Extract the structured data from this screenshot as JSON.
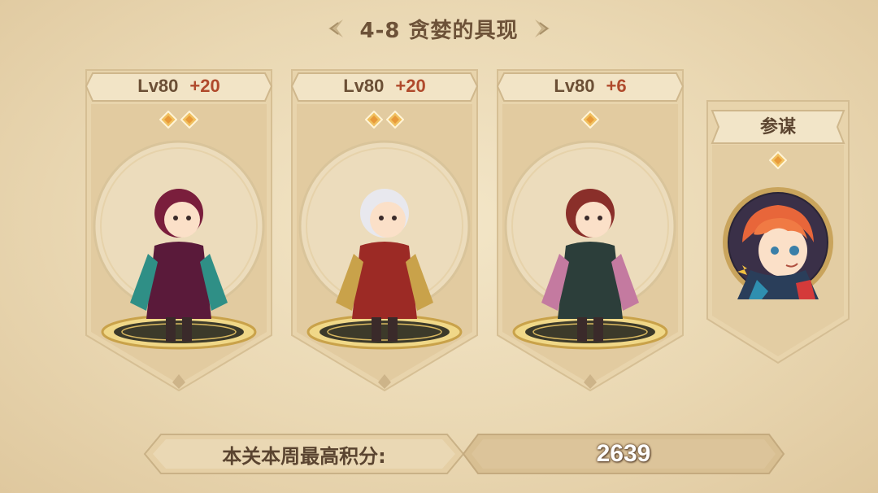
{
  "stage": {
    "title": "4-8 贪婪的具现"
  },
  "heroes": [
    {
      "level": "Lv80",
      "bonus": "+20",
      "stars": 2,
      "character": "sorceress",
      "colors": {
        "hair": "#7a1e3c",
        "robe": "#5a1a3a",
        "accent": "#2f8f86"
      }
    },
    {
      "level": "Lv80",
      "bonus": "+20",
      "stars": 2,
      "character": "white-bear-warrior",
      "colors": {
        "hair": "#e8e8ee",
        "robe": "#9c2a25",
        "accent": "#c9a24a"
      }
    },
    {
      "level": "Lv80",
      "bonus": "+6",
      "stars": 1,
      "character": "pirate-captain",
      "colors": {
        "hair": "#8a2f2a",
        "robe": "#2c3e3a",
        "accent": "#c47aa0"
      }
    }
  ],
  "advisor": {
    "label": "参谋",
    "stars": 1,
    "character": "red-haired-girl"
  },
  "score": {
    "label": "本关本周最高积分:",
    "value": "2639"
  }
}
